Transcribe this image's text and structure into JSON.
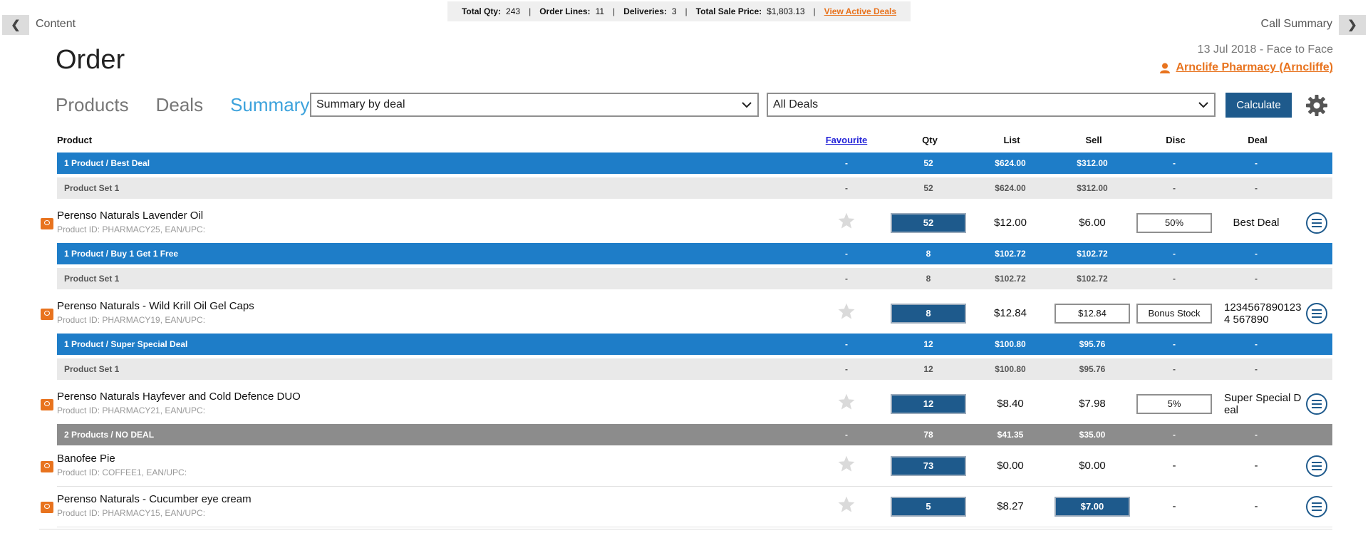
{
  "nav": {
    "back_label": "Content",
    "forward_label": "Call Summary"
  },
  "summary_bar": {
    "total_qty_label": "Total Qty:",
    "total_qty": "243",
    "order_lines_label": "Order Lines:",
    "order_lines": "11",
    "deliveries_label": "Deliveries:",
    "deliveries": "3",
    "total_sale_label": "Total Sale Price:",
    "total_sale": "$1,803.13",
    "view_deals": "View Active Deals"
  },
  "page_title": "Order",
  "date_line": "13 Jul 2018  -  Face to Face",
  "customer": "Arnclife Pharmacy (Arncliffe)",
  "tabs": [
    "Products",
    "Deals",
    "Summary"
  ],
  "summary_select": "Summary by deal",
  "deals_select": "All Deals",
  "calculate_label": "Calculate",
  "columns": {
    "product": "Product",
    "favourite": "Favourite",
    "qty": "Qty",
    "list": "List",
    "sell": "Sell",
    "disc": "Disc",
    "deal": "Deal"
  },
  "groups": [
    {
      "band": {
        "name": "1 Product / Best Deal",
        "fav": "-",
        "qty": "52",
        "list": "$624.00",
        "sell": "$312.00",
        "disc": "-",
        "deal": "-"
      },
      "set": {
        "name": "Product Set 1",
        "fav": "-",
        "qty": "52",
        "list": "$624.00",
        "sell": "$312.00",
        "disc": "-",
        "deal": "-"
      },
      "product": {
        "name": "Perenso Naturals Lavender Oil",
        "id": "Product ID: PHARMACY25, EAN/UPC:",
        "qty": "52",
        "list": "$12.00",
        "sell": "$6.00",
        "disc": "50%",
        "deal": "Best Deal"
      }
    },
    {
      "band": {
        "name": "1 Product / Buy 1 Get 1 Free",
        "fav": "-",
        "qty": "8",
        "list": "$102.72",
        "sell": "$102.72",
        "disc": "-",
        "deal": "-"
      },
      "set": {
        "name": "Product Set 1",
        "fav": "-",
        "qty": "8",
        "list": "$102.72",
        "sell": "$102.72",
        "disc": "-",
        "deal": "-"
      },
      "product": {
        "name": "Perenso Naturals - Wild Krill Oil Gel Caps",
        "id": "Product ID: PHARMACY19, EAN/UPC:",
        "qty": "8",
        "list": "$12.84",
        "sell": "$12.84",
        "disc": "Bonus Stock",
        "deal": "12345678901234 567890"
      }
    },
    {
      "band": {
        "name": "1 Product / Super Special Deal",
        "fav": "-",
        "qty": "12",
        "list": "$100.80",
        "sell": "$95.76",
        "disc": "-",
        "deal": "-"
      },
      "set": {
        "name": "Product Set 1",
        "fav": "-",
        "qty": "12",
        "list": "$100.80",
        "sell": "$95.76",
        "disc": "-",
        "deal": "-"
      },
      "product": {
        "name": "Perenso Naturals Hayfever and Cold Defence DUO",
        "id": "Product ID: PHARMACY21, EAN/UPC:",
        "qty": "12",
        "list": "$8.40",
        "sell": "$7.98",
        "disc": "5%",
        "deal": "Super Special Deal"
      }
    }
  ],
  "nodeal_band": {
    "name": "2 Products / NO DEAL",
    "fav": "-",
    "qty": "78",
    "list": "$41.35",
    "sell": "$35.00",
    "disc": "-",
    "deal": "-"
  },
  "nodeal_products": [
    {
      "name": "Banofee Pie",
      "id": "Product ID: COFFEE1, EAN/UPC:",
      "qty": "73",
      "list": "$0.00",
      "sell": "$0.00",
      "disc": "-",
      "deal": "-"
    },
    {
      "name": "Perenso Naturals - Cucumber eye cream",
      "id": "Product ID: PHARMACY15, EAN/UPC:",
      "qty": "5",
      "list": "$8.27",
      "sell": "$7.00",
      "disc": "-",
      "deal": "-"
    }
  ],
  "colors": {
    "accent": "#1e7dc8",
    "dark": "#1e5a8c",
    "orange": "#e8731e",
    "tab_active": "#3ca2dc"
  }
}
